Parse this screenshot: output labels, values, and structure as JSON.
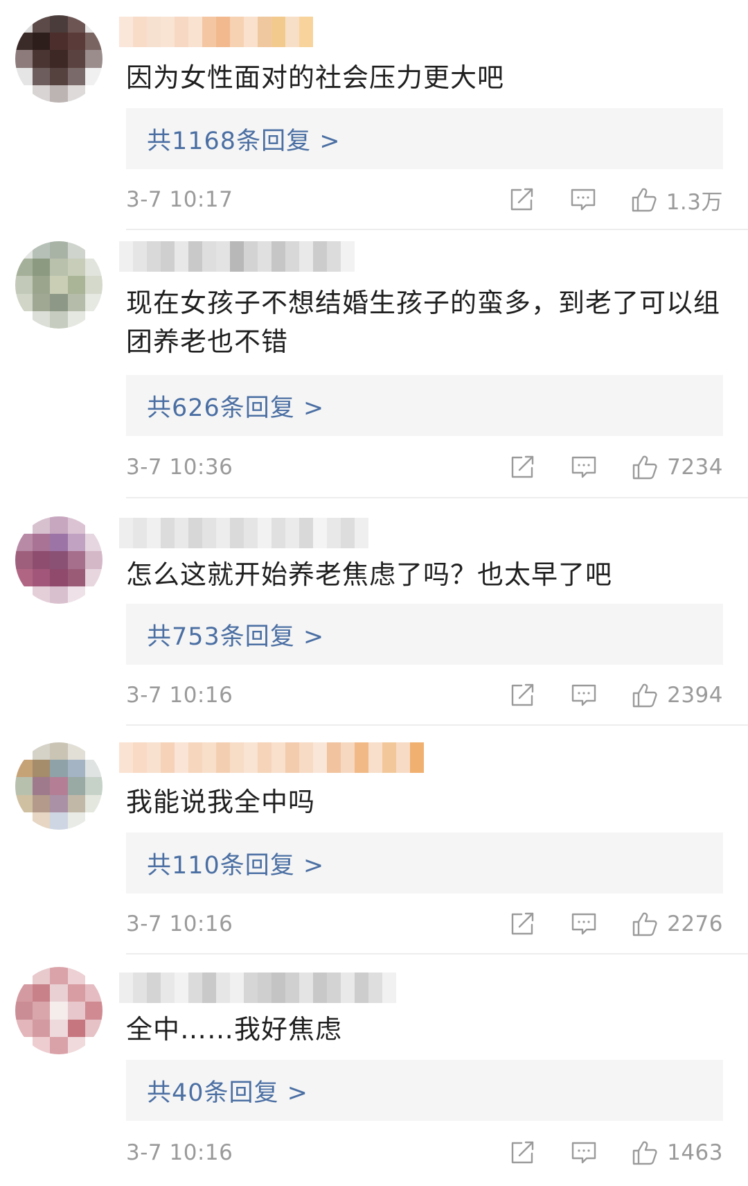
{
  "comments": [
    {
      "text": "因为女性面对的社会压力更大吧",
      "replies_label": "共1168条回复 >",
      "time": "3-7 10:17",
      "likes": "1.3万",
      "avatar_colors": [
        "#d9d9d9",
        "#5b4a48",
        "#4a3c3a",
        "#6d5553",
        "#e8e8e8",
        "#3a2a28",
        "#2d1d1b",
        "#4c2f2d",
        "#5a3b39",
        "#7a6462",
        "#8c7b7a",
        "#4a3533",
        "#3d2826",
        "#5a4240",
        "#9a8d8c",
        "#e5e5e5",
        "#6d5e5d",
        "#55423f",
        "#7a6b6a",
        "#f0f0f0",
        "#ffffff",
        "#d8d4d3",
        "#bcb4b3",
        "#dedada",
        "#ffffff"
      ],
      "name_colors": [
        "#fbe6da",
        "#f8dcc8",
        "#f6e0cf",
        "#f9e4d4",
        "#f7d8c2",
        "#f9e2d0",
        "#f4c7a2",
        "#f2b98f",
        "#f6d1b2",
        "#f9e1cd",
        "#f0c8a0",
        "#f3ca8e",
        "#f7dfc7",
        "#f8d39c"
      ]
    },
    {
      "text": "现在女孩子不想结婚生孩子的蛮多，到老了可以组团养老也不错",
      "replies_label": "共626条回复 >",
      "time": "3-7 10:36",
      "likes": "7234",
      "avatar_colors": [
        "#e3e6e2",
        "#b6c0b7",
        "#a8b3a6",
        "#cfd4cd",
        "#ffffff",
        "#a5b09a",
        "#8d9a82",
        "#b9c1ad",
        "#c7cdb9",
        "#e1e4dc",
        "#c3c9b8",
        "#9ba58e",
        "#c9ceb4",
        "#aab497",
        "#d5d9cc",
        "#d0d5c8",
        "#a0a894",
        "#8d9887",
        "#b5bca9",
        "#e6e8e2",
        "#ffffff",
        "#dcdfd8",
        "#c6ccbf",
        "#e5e7e1",
        "#ffffff"
      ],
      "name_colors": [
        "#f0f0f0",
        "#e5e5e5",
        "#d9d9d9",
        "#cfcfcf",
        "#e8e8e8",
        "#c9c9c9",
        "#dedede",
        "#e3e3e3",
        "#b8b8b8",
        "#d3d3d3",
        "#e0e0e0",
        "#c6c6c6",
        "#d8d8d8",
        "#e9e9e9",
        "#cccccc",
        "#dcdcdc",
        "#f2f2f2"
      ]
    },
    {
      "text": "怎么这就开始养老焦虑了吗？也太早了吧",
      "replies_label": "共753条回复 >",
      "time": "3-7 10:16",
      "likes": "2394",
      "avatar_colors": [
        "#ffffff",
        "#d7c1cf",
        "#c7a6bf",
        "#dbc3d3",
        "#ffffff",
        "#b88aa6",
        "#a97396",
        "#9c74a6",
        "#c2a2c2",
        "#e6d6e0",
        "#9e5f7c",
        "#8e4d6e",
        "#8a5175",
        "#a66f8c",
        "#d5b8c8",
        "#b06683",
        "#a2567a",
        "#8f4a6c",
        "#9a5b77",
        "#e8d6de",
        "#ffffff",
        "#e4cfd9",
        "#d9c0ce",
        "#eee2e8",
        "#ffffff"
      ],
      "name_colors": [
        "#eeeeee",
        "#e6e6e6",
        "#f0f0f0",
        "#dcdcdc",
        "#e9e9e9",
        "#d7d7d7",
        "#e3e3e3",
        "#ededed",
        "#dadada",
        "#e5e5e5",
        "#f2f2f2",
        "#e0e0e0",
        "#ebebeb",
        "#d9d9d9",
        "#f4f4f4",
        "#e8e8e8",
        "#dddddd",
        "#efefef"
      ]
    },
    {
      "text": "我能说我全中吗",
      "replies_label": "共110条回复 >",
      "time": "3-7 10:16",
      "likes": "2276",
      "avatar_colors": [
        "#ffffff",
        "#d5d2c8",
        "#c9c4b4",
        "#e1dfd6",
        "#ffffff",
        "#c6a277",
        "#a58c6a",
        "#8ea2a8",
        "#a5b4c4",
        "#dfe3e2",
        "#b7c0ad",
        "#9e7a8c",
        "#b47e94",
        "#98aaa3",
        "#c6d1c8",
        "#cfc0a2",
        "#b39a8a",
        "#aa91a5",
        "#c1b8a8",
        "#e4e7de",
        "#ffffff",
        "#e6d6c3",
        "#cfd6e3",
        "#e8ebe6",
        "#ffffff"
      ],
      "name_colors": [
        "#fbe3d3",
        "#f9dac4",
        "#f8e1cf",
        "#f5d2b8",
        "#f9e4d5",
        "#f6d6bd",
        "#f8dfca",
        "#f4ceb1",
        "#f7dcc6",
        "#f9e3d2",
        "#f5d4b9",
        "#f8e0cc",
        "#f3ccae",
        "#f7dbc4",
        "#f9e6d8",
        "#f1c39f",
        "#f6d8c0",
        "#f0b986",
        "#f8dfcb",
        "#f2c89a",
        "#f7dbc5",
        "#f0b070"
      ]
    },
    {
      "text": "全中……我好焦虑",
      "replies_label": "共40条回复 >",
      "time": "3-7 10:16",
      "likes": "1463",
      "avatar_colors": [
        "#ffffff",
        "#e8c9cc",
        "#d9a3a9",
        "#ecd0d3",
        "#ffffff",
        "#d49aa1",
        "#c98189",
        "#e8d0d3",
        "#d89ca3",
        "#e5bcc1",
        "#cb8d95",
        "#d8a6ab",
        "#f5ecec",
        "#e7c7cb",
        "#d08a92",
        "#e2b6bb",
        "#d49aa1",
        "#eed9dc",
        "#c6767f",
        "#e6c1c5",
        "#ffffff",
        "#eecdd0",
        "#d9a1a8",
        "#f0dadc",
        "#ffffff"
      ],
      "name_colors": [
        "#eeeeee",
        "#e2e2e2",
        "#d4d4d4",
        "#e8e8e8",
        "#f2f2f2",
        "#dbdbdb",
        "#c9c9c9",
        "#e6e6e6",
        "#f0f0f0",
        "#d6d6d6",
        "#cfcfcf",
        "#c4c4c4",
        "#d0d0d0",
        "#e4e4e4",
        "#c8c8c8",
        "#d3d3d3",
        "#e9e9e9",
        "#cdcdcd",
        "#dedede",
        "#f1f1f1"
      ]
    }
  ]
}
